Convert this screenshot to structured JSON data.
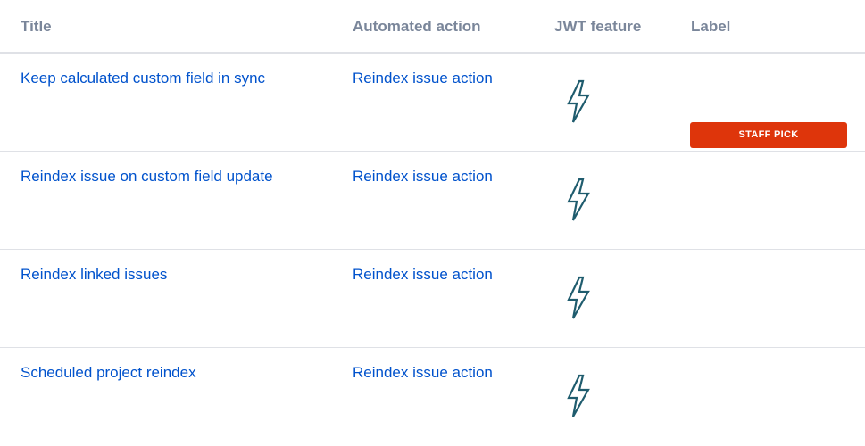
{
  "table": {
    "headers": {
      "title": "Title",
      "action": "Automated action",
      "feature": "JWT feature",
      "label": "Label"
    },
    "rows": [
      {
        "title": "Keep calculated custom field in sync",
        "action": "Reindex issue action",
        "feature_icon": "lightning-bolt-icon",
        "label": "STAFF PICK"
      },
      {
        "title": "Reindex issue on custom field update",
        "action": "Reindex issue action",
        "feature_icon": "lightning-bolt-icon",
        "label": ""
      },
      {
        "title": "Reindex linked issues",
        "action": "Reindex issue action",
        "feature_icon": "lightning-bolt-icon",
        "label": ""
      },
      {
        "title": "Scheduled project reindex",
        "action": "Reindex issue action",
        "feature_icon": "lightning-bolt-icon",
        "label": ""
      }
    ]
  },
  "colors": {
    "link": "#0052cc",
    "header_text": "#7a869a",
    "badge_bg": "#de350b",
    "icon_stroke": "#1f5c6e"
  }
}
